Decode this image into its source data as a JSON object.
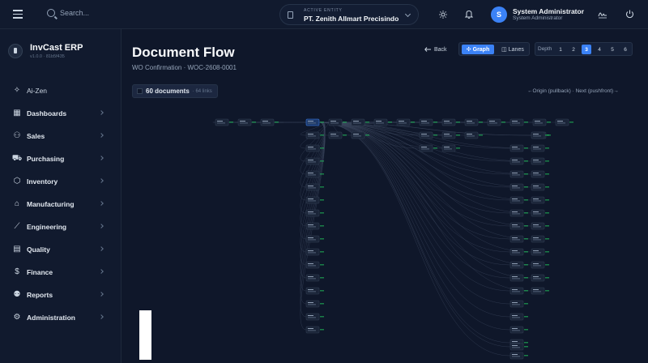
{
  "topbar": {
    "search_placeholder": "Search...",
    "entity_label": "ACTIVE ENTITY",
    "entity_name": "PT. Zenith Allmart Precisindo",
    "user_initial": "S",
    "user_name": "System Administrator",
    "user_role": "System Administrator"
  },
  "sidebar": {
    "brand": "InvCast ERP",
    "version": "v1.0.0 · 81b5f435",
    "items": [
      {
        "label": "Ai-Zen",
        "icon": "sparkle-icon",
        "chevron": false
      },
      {
        "label": "Dashboards",
        "icon": "grid-icon",
        "chevron": true
      },
      {
        "label": "Sales",
        "icon": "users-icon",
        "chevron": true
      },
      {
        "label": "Purchasing",
        "icon": "cart-icon",
        "chevron": true
      },
      {
        "label": "Inventory",
        "icon": "box-icon",
        "chevron": true
      },
      {
        "label": "Manufacturing",
        "icon": "factory-icon",
        "chevron": true
      },
      {
        "label": "Engineering",
        "icon": "trend-icon",
        "chevron": true
      },
      {
        "label": "Quality",
        "icon": "clipboard-icon",
        "chevron": true
      },
      {
        "label": "Finance",
        "icon": "dollar-icon",
        "chevron": true
      },
      {
        "label": "Reports",
        "icon": "person-icon",
        "chevron": true
      },
      {
        "label": "Administration",
        "icon": "gear-icon",
        "chevron": true
      }
    ]
  },
  "main": {
    "title": "Document Flow",
    "subtitle": "WO Confirmation · WOC-2608-0001",
    "doc_count": "60 documents",
    "link_count": "· 64 links",
    "direction_hint": "←Origin (pullback) · Next (pushfront)→",
    "back_label": "Back",
    "view_graph": "Graph",
    "view_lanes": "Lanes",
    "depth_label": "Depth",
    "depth_options": [
      "1",
      "2",
      "3",
      "4",
      "5",
      "6"
    ],
    "depth_selected": "3"
  },
  "colors": {
    "accent": "#3b82f6",
    "background": "#0f172a",
    "panel": "#111a2e"
  }
}
